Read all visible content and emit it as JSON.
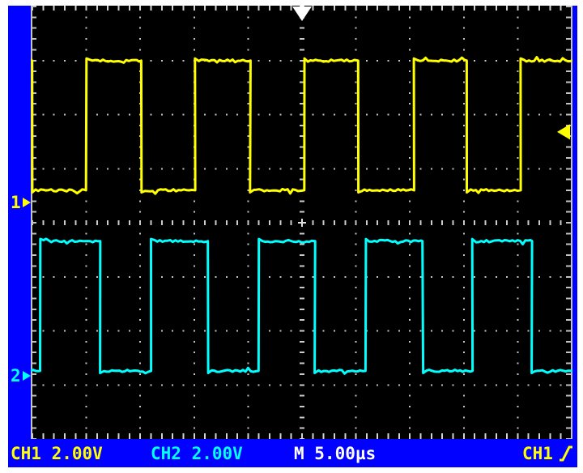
{
  "scope": {
    "colors": {
      "bezel_blue": "#0101ff",
      "screen_black": "#000000",
      "grid_gray": "#c8c8c8",
      "ch1_yellow": "#ffff00",
      "ch2_cyan": "#00ffff",
      "readout_white": "#ffffff"
    },
    "channel_markers": {
      "ch1_label": "1",
      "ch2_label": "2"
    },
    "status_bar": {
      "ch1_scale": "CH1 2.00V",
      "ch2_scale": "CH2 2.00V",
      "timebase": "M 5.00µs",
      "trigger_source": "CH1",
      "trigger_slope_icon": "rising-edge"
    }
  },
  "chart_data": {
    "type": "line",
    "title": "Dual-channel oscilloscope display: two ~100 kHz square waves",
    "x_units": "µs",
    "divisions": {
      "x": 10,
      "y": 8
    },
    "timebase_us_per_div": 5.0,
    "x_range_us": [
      -25,
      25
    ],
    "grid": "dotted division lines, minor ticks every 1/5 division",
    "legend": false,
    "trigger": {
      "source": "CH1",
      "slope": "rising",
      "position_div_from_left": 5,
      "level_div_from_top": 2.32
    },
    "series": [
      {
        "name": "CH1",
        "color": "#ffff00",
        "volts_per_div": 2.0,
        "state_at_left": "high",
        "high_level_div_from_top": 1.0,
        "low_level_div_from_top": 3.4,
        "ground_marker_div_from_top": 3.63,
        "fall_times_us": [
          -25.1,
          -14.9,
          -4.8,
          5.2,
          15.3
        ],
        "rise_times_us": [
          -20.0,
          -9.9,
          0.2,
          10.4,
          20.3
        ]
      },
      {
        "name": "CH2",
        "color": "#00ffff",
        "volts_per_div": 2.0,
        "state_at_left": "low",
        "high_level_div_from_top": 4.34,
        "low_level_div_from_top": 6.74,
        "ground_marker_div_from_top": 6.83,
        "rise_times_us": [
          -24.3,
          -14.0,
          -4.0,
          5.9,
          15.8
        ],
        "fall_times_us": [
          -18.7,
          -8.7,
          1.2,
          11.2,
          21.3
        ]
      }
    ]
  }
}
